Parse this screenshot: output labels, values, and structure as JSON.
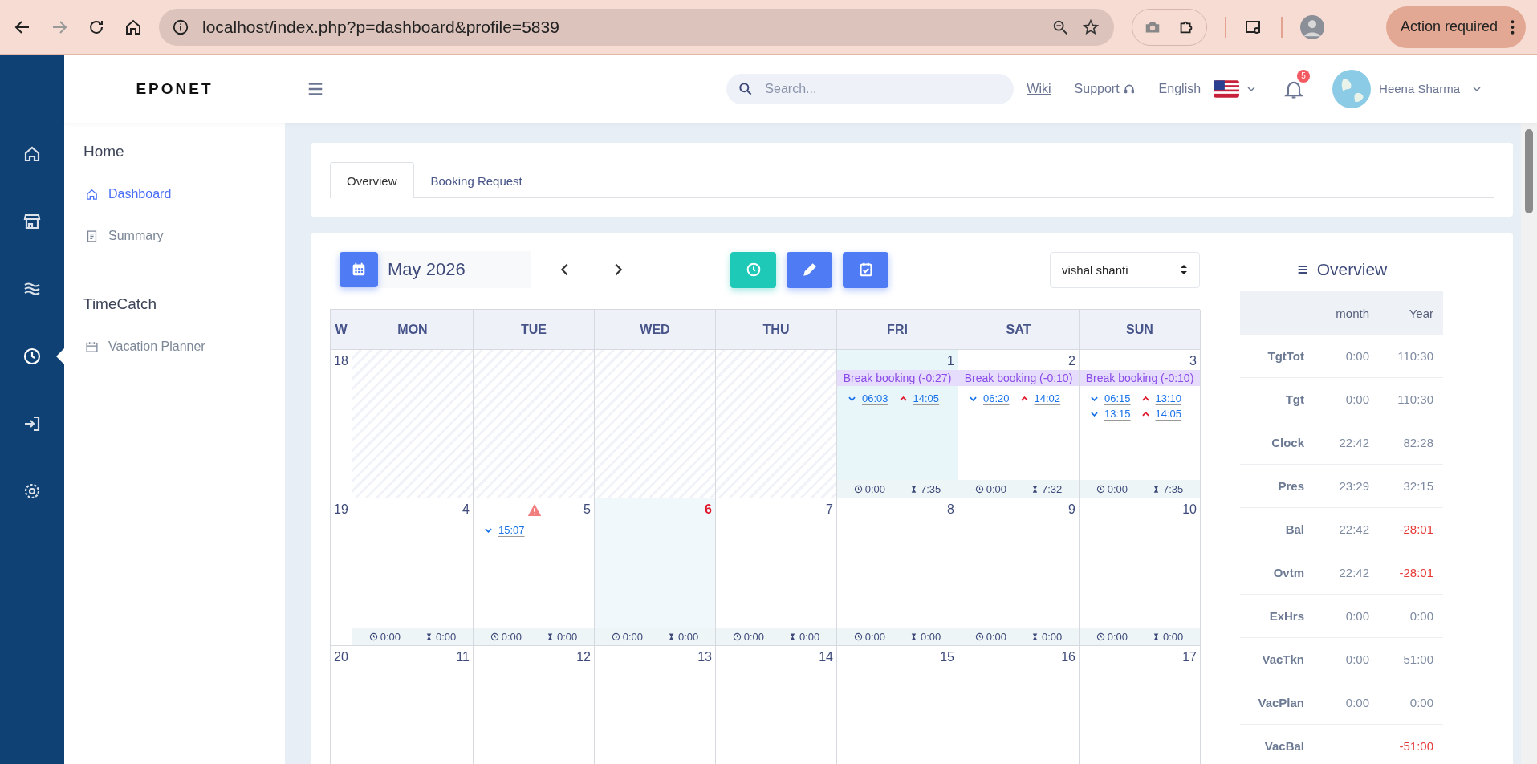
{
  "browser": {
    "url": "localhost/index.php?p=dashboard&profile=5839",
    "action": "Action required"
  },
  "brand": "EPONET",
  "header": {
    "search_placeholder": "Search...",
    "wiki": "Wiki",
    "support": "Support",
    "language": "English",
    "notifications": "5",
    "user": "Heena Sharma"
  },
  "rail": [
    {
      "kind": "home",
      "selected": false
    },
    {
      "kind": "store",
      "selected": false
    },
    {
      "kind": "waves",
      "selected": false
    },
    {
      "kind": "clock",
      "selected": true
    },
    {
      "kind": "login",
      "selected": false
    },
    {
      "kind": "gear",
      "selected": false
    }
  ],
  "sidebar": [
    {
      "title": "Home",
      "items": [
        {
          "label": "Dashboard",
          "kind": "home",
          "selected": true
        },
        {
          "label": "Summary",
          "kind": "doc",
          "selected": false
        }
      ]
    },
    {
      "title": "TimeCatch",
      "items": [
        {
          "label": "Vacation Planner",
          "kind": "calendar",
          "selected": false
        }
      ]
    }
  ],
  "tabs": [
    {
      "label": "Overview",
      "selected": true
    },
    {
      "label": "Booking Request",
      "selected": false
    }
  ],
  "calendar": {
    "month": "May 2026",
    "employee": "vishal shanti",
    "actions": [
      {
        "kind": "clock"
      },
      {
        "kind": "edit"
      },
      {
        "kind": "check"
      }
    ],
    "headers": [
      "W",
      "MON",
      "TUE",
      "WED",
      "THU",
      "FRI",
      "SAT",
      "SUN"
    ],
    "weeks": [
      {
        "number": "18",
        "days": [
          {
            "kind": "outside"
          },
          {
            "kind": "outside"
          },
          {
            "kind": "outside"
          },
          {
            "kind": "outside"
          },
          {
            "kind": "day",
            "date": "1",
            "highlighted": true,
            "today": false,
            "warning": false,
            "note": "Break booking (-0:27)",
            "bookings": [
              {
                "kind": "in",
                "time": "06:03"
              },
              {
                "kind": "out",
                "time": "14:05"
              }
            ],
            "clock": "0:00",
            "duration": "7:35"
          },
          {
            "kind": "day",
            "date": "2",
            "highlighted": false,
            "today": false,
            "warning": false,
            "note": "Break booking (-0:10)",
            "bookings": [
              {
                "kind": "in",
                "time": "06:20"
              },
              {
                "kind": "out",
                "time": "14:02"
              }
            ],
            "clock": "0:00",
            "duration": "7:32"
          },
          {
            "kind": "day",
            "date": "3",
            "highlighted": false,
            "today": false,
            "warning": false,
            "note": "Break booking (-0:10)",
            "bookings": [
              {
                "kind": "in",
                "time": "06:15"
              },
              {
                "kind": "out",
                "time": "13:10"
              },
              {
                "kind": "in",
                "time": "13:15"
              },
              {
                "kind": "out",
                "time": "14:05"
              }
            ],
            "clock": "0:00",
            "duration": "7:35"
          }
        ]
      },
      {
        "number": "19",
        "days": [
          {
            "kind": "day",
            "date": "4",
            "highlighted": false,
            "today": false,
            "warning": false,
            "clock": "0:00",
            "duration": "0:00"
          },
          {
            "kind": "day",
            "date": "5",
            "highlighted": false,
            "today": false,
            "warning": true,
            "bookings": [
              {
                "kind": "in",
                "time": "15:07"
              }
            ],
            "clock": "0:00",
            "duration": "0:00"
          },
          {
            "kind": "day",
            "date": "6",
            "highlighted": true,
            "today": true,
            "warning": false,
            "clock": "0:00",
            "duration": "0:00"
          },
          {
            "kind": "day",
            "date": "7",
            "highlighted": false,
            "today": false,
            "warning": false,
            "clock": "0:00",
            "duration": "0:00"
          },
          {
            "kind": "day",
            "date": "8",
            "highlighted": false,
            "today": false,
            "warning": false,
            "clock": "0:00",
            "duration": "0:00"
          },
          {
            "kind": "day",
            "date": "9",
            "highlighted": false,
            "today": false,
            "warning": false,
            "clock": "0:00",
            "duration": "0:00"
          },
          {
            "kind": "day",
            "date": "10",
            "highlighted": false,
            "today": false,
            "warning": false,
            "clock": "0:00",
            "duration": "0:00"
          }
        ]
      },
      {
        "number": "20",
        "days": [
          {
            "kind": "day",
            "date": "11",
            "highlighted": false,
            "today": false,
            "warning": false
          },
          {
            "kind": "day",
            "date": "12",
            "highlighted": false,
            "today": false,
            "warning": false
          },
          {
            "kind": "day",
            "date": "13",
            "highlighted": false,
            "today": false,
            "warning": false
          },
          {
            "kind": "day",
            "date": "14",
            "highlighted": false,
            "today": false,
            "warning": false
          },
          {
            "kind": "day",
            "date": "15",
            "highlighted": false,
            "today": false,
            "warning": false
          },
          {
            "kind": "day",
            "date": "16",
            "highlighted": false,
            "today": false,
            "warning": false
          },
          {
            "kind": "day",
            "date": "17",
            "highlighted": false,
            "today": false,
            "warning": false
          }
        ]
      }
    ]
  },
  "overview": {
    "title": "Overview",
    "columns": [
      "month",
      "Year"
    ],
    "rows": [
      {
        "label": "TgtTot",
        "month": "0:00",
        "year": "110:30",
        "negative": false
      },
      {
        "label": "Tgt",
        "month": "0:00",
        "year": "110:30",
        "negative": false
      },
      {
        "label": "Clock",
        "month": "22:42",
        "year": "82:28",
        "negative": false
      },
      {
        "label": "Pres",
        "month": "23:29",
        "year": "32:15",
        "negative": false
      },
      {
        "label": "Bal",
        "month": "22:42",
        "year": "-28:01",
        "negative": true
      },
      {
        "label": "Ovtm",
        "month": "22:42",
        "year": "-28:01",
        "negative": true
      },
      {
        "label": "ExHrs",
        "month": "0:00",
        "year": "0:00",
        "negative": false
      },
      {
        "label": "VacTkn",
        "month": "0:00",
        "year": "51:00",
        "negative": false
      },
      {
        "label": "VacPlan",
        "month": "0:00",
        "year": "0:00",
        "negative": false
      },
      {
        "label": "VacBal",
        "year": "-51:00",
        "negative": true
      }
    ]
  }
}
